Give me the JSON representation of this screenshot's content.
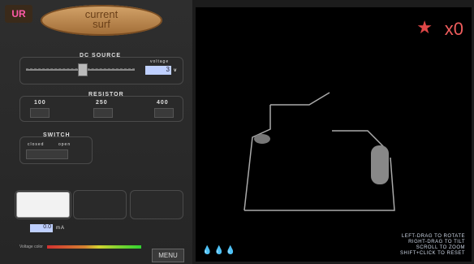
{
  "app": {
    "title_line1": "current",
    "title_line2": "surf"
  },
  "dc_source": {
    "title": "DC SOURCE",
    "voltage_label": "voltage",
    "voltage_value": "3",
    "voltage_unit": "v"
  },
  "resistor": {
    "title": "RESISTOR",
    "options": [
      "100",
      "250",
      "400"
    ]
  },
  "switch": {
    "title": "SWITCH",
    "closed": "closed",
    "open": "open"
  },
  "meter": {
    "reading": "0.0",
    "unit": "mA"
  },
  "voltage_color_label": "Voltage color",
  "menu": "MENU",
  "scene": {
    "count": "x0",
    "help": [
      "LEFT-DRAG TO ROTATE",
      "RIGHT-DRAG TO TILT",
      "SCROLL TO ZOOM",
      "SHIFT+CLICK TO RESET"
    ],
    "lives": "💧💧💧"
  }
}
